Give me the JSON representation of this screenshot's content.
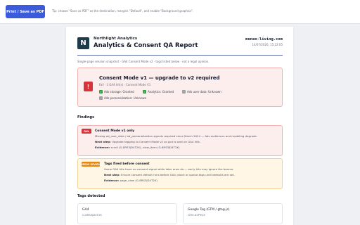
{
  "toolbar": {
    "print_label": "Print / Save as PDF",
    "tip": "Tip: choose \"Save as PDF\" as the destination, margins \"Default\", and enable \"Background graphics\"."
  },
  "report": {
    "logo_letter": "N",
    "brand": "Northlight Analytics",
    "title": "Analytics & Consent QA Report",
    "domain": "meneo-living.com",
    "date": "14/07/2026, 15:22:05",
    "subtitle": "Single-page session snapshot · GA4 Consent Mode v2 · tags listed below · not a legal opinion."
  },
  "alert": {
    "icon": "!",
    "title": "Consent Mode v1 — upgrade to v2 required",
    "subtitle": "Fail · 3 GA4 hit(s) · Consent Mode V1",
    "signals": [
      {
        "label": "Ads storage: Granted",
        "state": "granted",
        "mark": "✓"
      },
      {
        "label": "Analytics: Granted",
        "state": "granted",
        "mark": "✓"
      },
      {
        "label": "Ads user data: Unknown",
        "state": "unknown",
        "mark": "–"
      },
      {
        "label": "Ads personalization: Unknown",
        "state": "unknown",
        "mark": "–"
      }
    ]
  },
  "findings_heading": "Findings",
  "findings": [
    {
      "badge": "FAIL",
      "title": "Consent Mode v1 only",
      "desc": "Missing ad_user_data / ad_personalization signals required since March 2024 — Ads audiences and modeling degrade.",
      "next_label": "Next step:",
      "next": "Upgrade tagging to Consent Mode v2 so gcd is sent on GA4 hits.",
      "evidence_label": "Evidence:",
      "evidence": "scroll (G-8RS3JD4T2K), view_item (G-8RS3JD4T2K)"
    },
    {
      "badge": "NEEDS REVIEW",
      "title": "Tags fired before consent",
      "desc": "Some GA4 hits have no consent signal while later ones do — early hits may ignore the banner.",
      "next_label": "Next step:",
      "next": "Ensure consent default runs before GA4; block or queue tags until defaults are set.",
      "evidence_label": "Evidence:",
      "evidence": "page_view (G-8RS3JD4T2K)"
    }
  ],
  "tags_heading": "Tags detected",
  "tags": [
    {
      "name": "GA4",
      "id": "G-8RS3JD4T2K"
    },
    {
      "name": "Google Tag (GTM / gtag.js)",
      "id": "GTM-K2P9QX"
    }
  ]
}
